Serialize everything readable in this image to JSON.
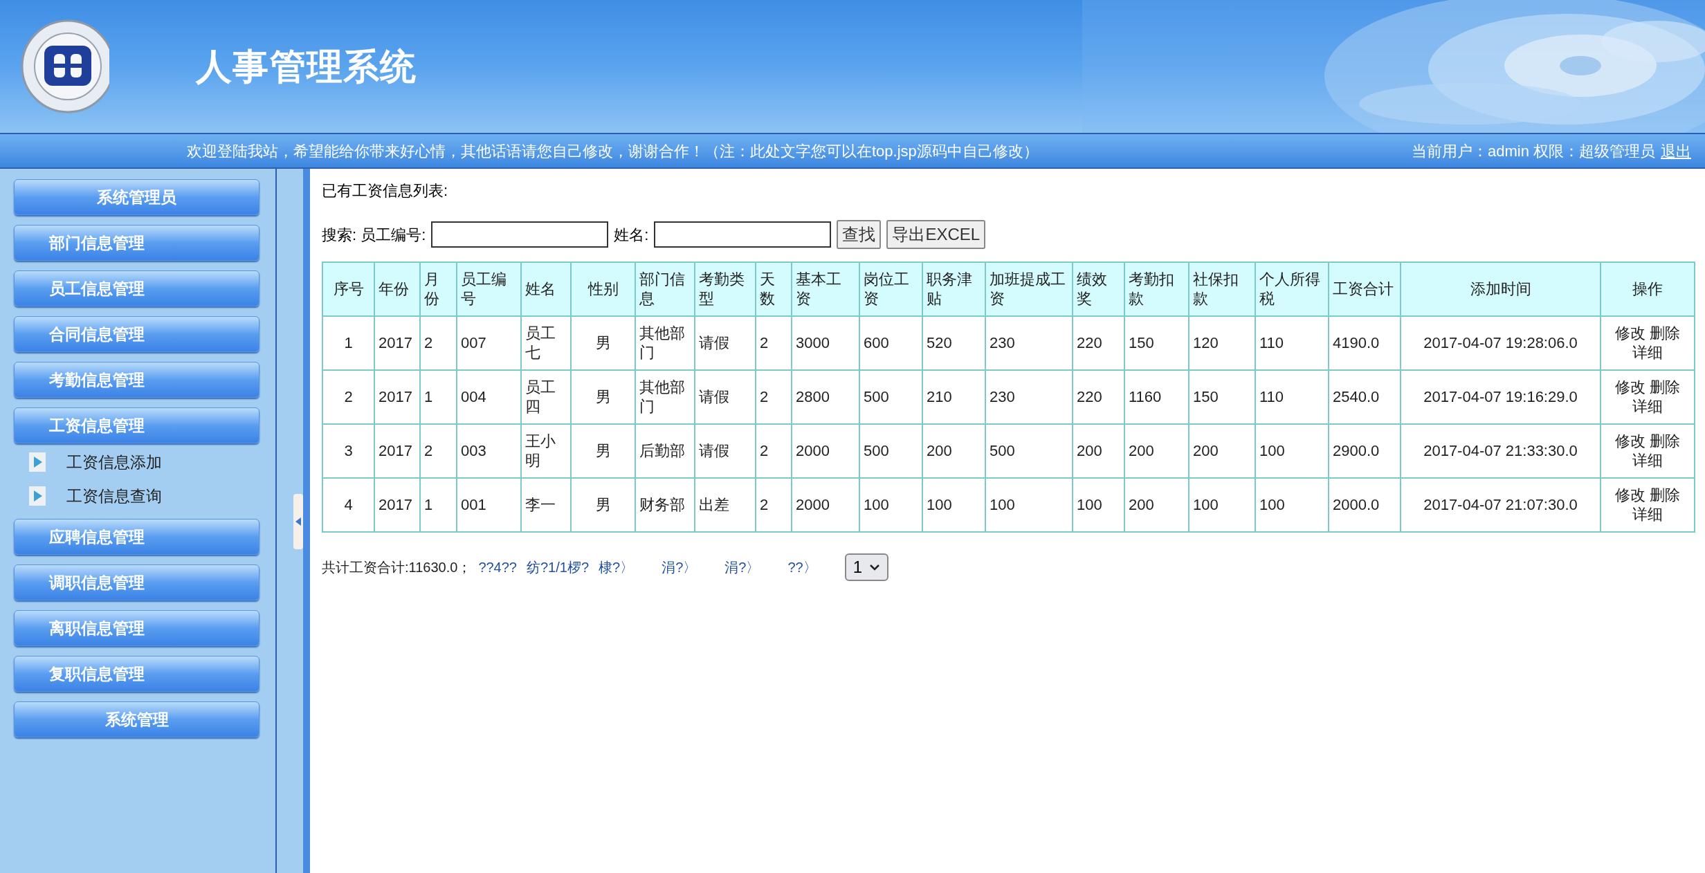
{
  "header": {
    "title": "人事管理系统"
  },
  "banner": {
    "message": "欢迎登陆我站，希望能给你带来好心情，其他话语请您自己修改，谢谢合作！（注：此处文字您可以在top.jsp源码中自己修改）",
    "user_info": "当前用户：admin 权限：超级管理员",
    "logout": "退出"
  },
  "sidebar": {
    "items": [
      {
        "kind": "title",
        "label": "系统管理员"
      },
      {
        "kind": "group",
        "label": "部门信息管理"
      },
      {
        "kind": "group",
        "label": "员工信息管理"
      },
      {
        "kind": "group",
        "label": "合同信息管理"
      },
      {
        "kind": "group",
        "label": "考勤信息管理"
      },
      {
        "kind": "group",
        "label": "工资信息管理",
        "children": [
          {
            "label": "工资信息添加"
          },
          {
            "label": "工资信息查询"
          }
        ]
      },
      {
        "kind": "group",
        "label": "应聘信息管理"
      },
      {
        "kind": "group",
        "label": "调职信息管理"
      },
      {
        "kind": "group",
        "label": "离职信息管理"
      },
      {
        "kind": "group",
        "label": "复职信息管理"
      },
      {
        "kind": "title",
        "label": "系统管理"
      }
    ]
  },
  "content": {
    "heading": "已有工资信息列表:",
    "search": {
      "label": "搜索: 员工编号:",
      "name_label": "姓名:",
      "buttons": [
        "查找",
        "导出EXCEL"
      ]
    },
    "table": {
      "columns": [
        "序号",
        "年份",
        "月份",
        "员工编号",
        "姓名",
        "性别",
        "部门信息",
        "考勤类型",
        "天数",
        "基本工资",
        "岗位工资",
        "职务津贴",
        "加班提成工资",
        "绩效奖",
        "考勤扣款",
        "社保扣款",
        "个人所得税",
        "工资合计",
        "添加时间",
        "操作"
      ],
      "rows": [
        {
          "cells": [
            "1",
            "2017",
            "2",
            "007",
            "员工七",
            "男",
            "其他部门",
            "请假",
            "2",
            "3000",
            "600",
            "520",
            "230",
            "220",
            "150",
            "120",
            "110",
            "4190.0",
            "2017-04-07 19:28:06.0"
          ],
          "actions": [
            "修改",
            "删除",
            "详细"
          ]
        },
        {
          "cells": [
            "2",
            "2017",
            "1",
            "004",
            "员工四",
            "男",
            "其他部门",
            "请假",
            "2",
            "2800",
            "500",
            "210",
            "230",
            "220",
            "1160",
            "150",
            "110",
            "2540.0",
            "2017-04-07 19:16:29.0"
          ],
          "actions": [
            "修改",
            "删除",
            "详细"
          ]
        },
        {
          "cells": [
            "3",
            "2017",
            "2",
            "003",
            "王小明",
            "男",
            "后勤部",
            "请假",
            "2",
            "2000",
            "500",
            "200",
            "500",
            "200",
            "200",
            "200",
            "100",
            "2900.0",
            "2017-04-07 21:33:30.0"
          ],
          "actions": [
            "修改",
            "删除",
            "详细"
          ]
        },
        {
          "cells": [
            "4",
            "2017",
            "1",
            "001",
            "李一",
            "男",
            "财务部",
            "出差",
            "2",
            "2000",
            "100",
            "100",
            "100",
            "100",
            "200",
            "100",
            "100",
            "2000.0",
            "2017-04-07 21:07:30.0"
          ],
          "actions": [
            "修改",
            "删除",
            "详细"
          ]
        }
      ]
    },
    "footer": {
      "total": "共计工资合计:11630.0；",
      "links": [
        "??4??",
        "纺?1/1椤?",
        "棣?〉",
        "涓?〉",
        "涓?〉",
        "??〉"
      ],
      "page_select": "1"
    }
  }
}
